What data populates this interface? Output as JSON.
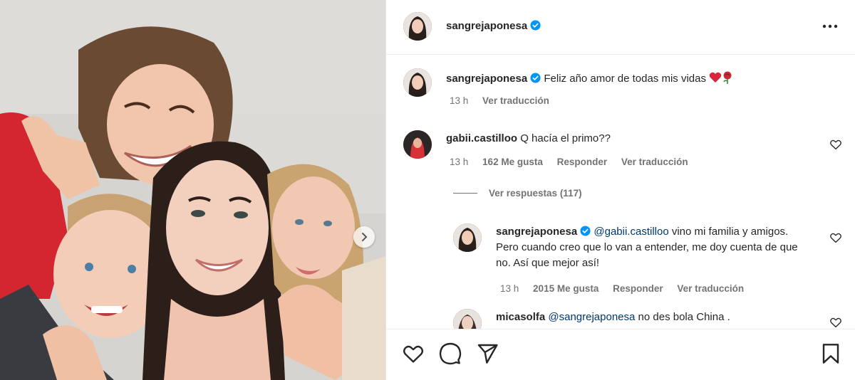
{
  "post": {
    "author": "sangrejaponesa",
    "verified": true,
    "caption_text": "Feliz año amor de todas mis vidas",
    "caption_emoji": "❤️🌹",
    "caption_time": "13 h",
    "caption_translate": "Ver traducción"
  },
  "comments": [
    {
      "username": "gabii.castilloo",
      "text": "Q hacía el primo??",
      "time": "13 h",
      "likes": "162 Me gusta",
      "reply": "Responder",
      "translate": "Ver traducción",
      "view_replies": "Ver respuestas (117)",
      "replies": [
        {
          "username": "sangrejaponesa",
          "mention": "@gabii.castilloo",
          "text": "vino mi familia y amigos. Pero cuando creo que lo van a entender, me doy cuenta de que no. Así que mejor así!",
          "time": "13 h",
          "likes": "2015 Me gusta",
          "reply": "Responder",
          "translate": "Ver traducción"
        }
      ]
    },
    {
      "username": "micasolfa",
      "mention": "@sangrejaponesa",
      "text": "no des bola China ."
    }
  ],
  "icons": {
    "more": "more-horizontal-icon",
    "like": "heart-icon",
    "comment": "comment-icon",
    "share": "send-icon",
    "save": "bookmark-icon",
    "next": "chevron-right-icon"
  },
  "colors": {
    "verified": "#0095f6",
    "heart": "#d7263d",
    "secondary": "#737373",
    "mention": "#00376b"
  }
}
